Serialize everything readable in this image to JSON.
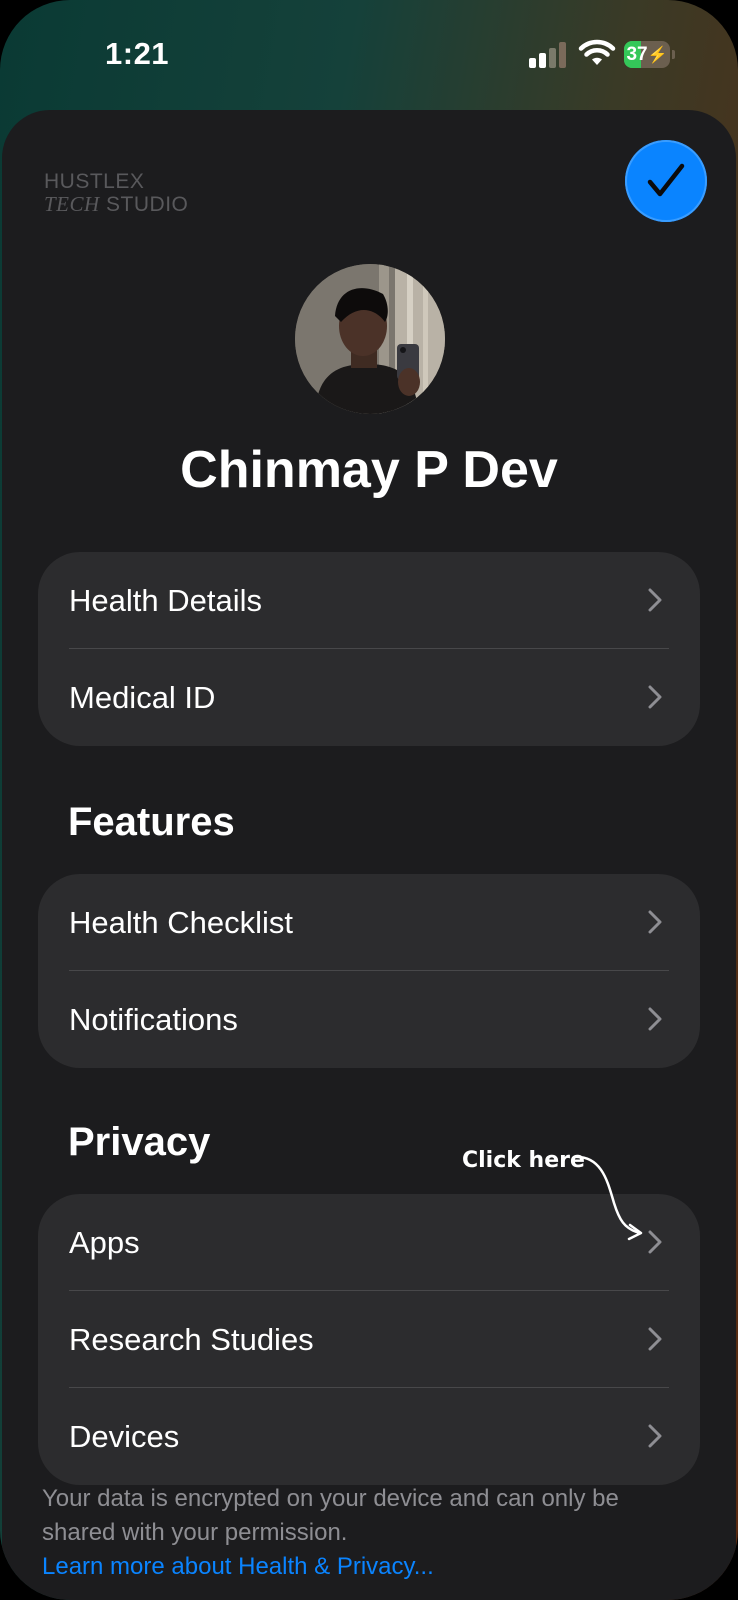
{
  "status_bar": {
    "time": "1:21",
    "battery_level": "37"
  },
  "watermark": {
    "line1": "HUSTLEX",
    "line2_italic": "TECH",
    "line2_rest": " STUDIO"
  },
  "profile": {
    "name": "Chinmay P Dev"
  },
  "group1": {
    "items": [
      {
        "label": "Health Details"
      },
      {
        "label": "Medical ID"
      }
    ]
  },
  "features": {
    "title": "Features",
    "items": [
      {
        "label": "Health Checklist"
      },
      {
        "label": "Notifications"
      }
    ]
  },
  "privacy": {
    "title": "Privacy",
    "items": [
      {
        "label": "Apps"
      },
      {
        "label": "Research Studies"
      },
      {
        "label": "Devices"
      }
    ]
  },
  "annotation": {
    "text": "Click here"
  },
  "footer": {
    "text": "Your data is encrypted on your device and can only be shared with your permission.",
    "link": "Learn more about Health & Privacy..."
  },
  "colors": {
    "accent": "#0a84ff",
    "background": "#1c1c1e",
    "cell": "#2c2c2e",
    "battery": "#34c759"
  },
  "icons": [
    "signal-icon",
    "wifi-icon",
    "battery-icon",
    "checkmark-icon",
    "chevron-right-icon",
    "curved-arrow-icon"
  ]
}
